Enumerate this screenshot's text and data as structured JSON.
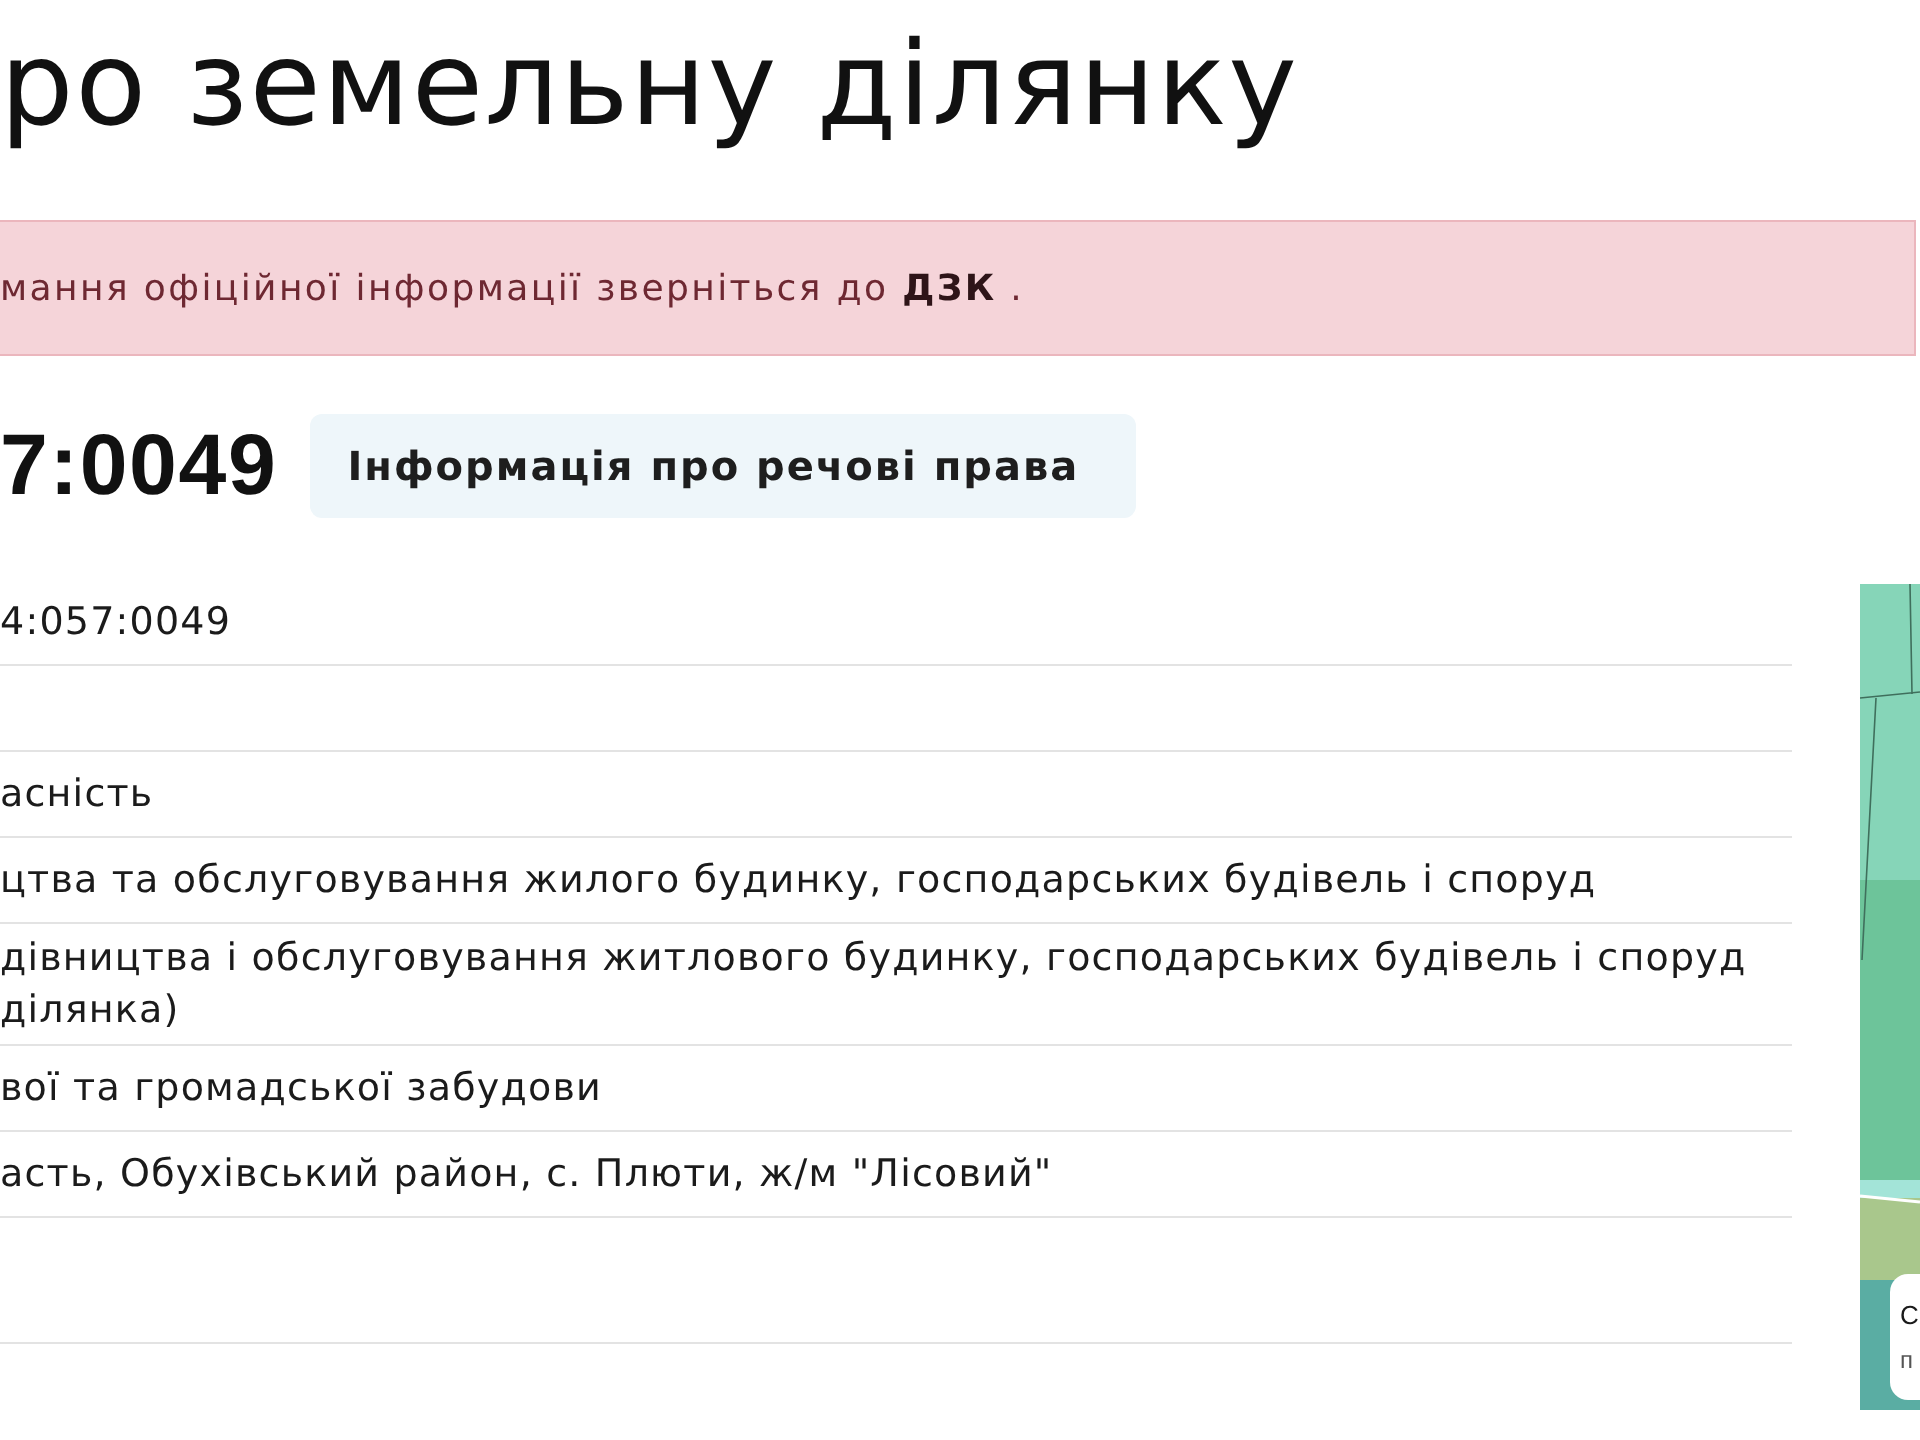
{
  "page_title": "ро земельну ділянку",
  "notice": {
    "text": "мання офіційної інформації зверніться до **ДЗК** ."
  },
  "cadastral_number": "7:0049",
  "rights_button": {
    "label": "Інформація про речові права"
  },
  "details_rows": [
    {
      "kind": "text",
      "lines": [
        "4:057:0049"
      ]
    },
    {
      "kind": "blank"
    },
    {
      "kind": "text",
      "lines": [
        "асність"
      ]
    },
    {
      "kind": "text",
      "lines": [
        "цтва та обслуговування жилого будинку, господарських будівель і споруд"
      ]
    },
    {
      "kind": "text",
      "lines": [
        "дівництва і обслуговування житлового будинку, господарських будівель і споруд",
        "ділянка)"
      ]
    },
    {
      "kind": "text",
      "lines": [
        "вої та громадської забудови"
      ]
    },
    {
      "kind": "text",
      "lines": [
        "асть, Обухівський район, с. Плюти, ж/м \"Лісовий\""
      ]
    },
    {
      "kind": "blank"
    }
  ],
  "map": {
    "popup_lines": [
      "С",
      "п"
    ]
  }
}
